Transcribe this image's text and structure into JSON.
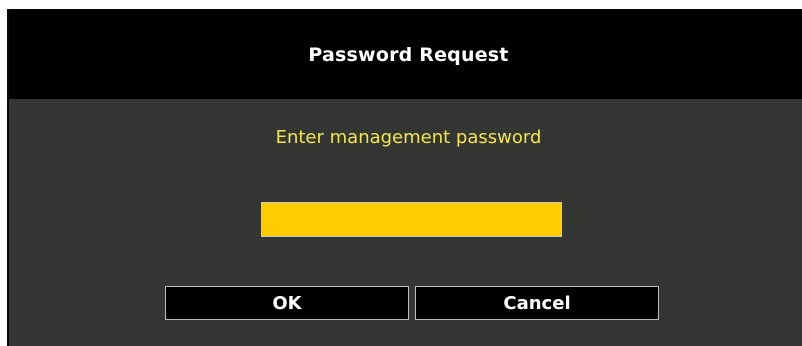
{
  "dialog": {
    "title": "Password Request",
    "prompt": "Enter management password",
    "password_value": "",
    "ok_label": "OK",
    "cancel_label": "Cancel"
  },
  "colors": {
    "title_bar_bg": "#000000",
    "body_bg": "#343633",
    "prompt_text": "#f5e54a",
    "input_bg": "#ffcc00",
    "button_bg": "#000000",
    "button_text": "#ffffff"
  }
}
